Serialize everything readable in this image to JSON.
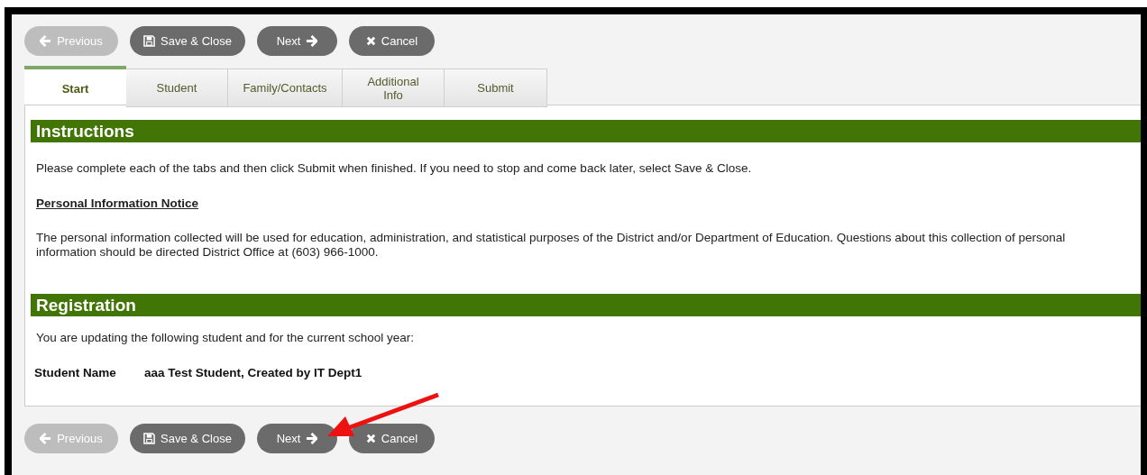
{
  "top_toolbar": [
    {
      "label": "Previous",
      "kind": "previous",
      "disabled": true
    },
    {
      "label": "Save & Close",
      "kind": "save",
      "disabled": false
    },
    {
      "label": "Next",
      "kind": "next",
      "disabled": false
    },
    {
      "label": "Cancel",
      "kind": "cancel",
      "disabled": false
    }
  ],
  "tabs": [
    {
      "label": "Start",
      "selected": true
    },
    {
      "label": "Student",
      "selected": false
    },
    {
      "label": "Family/Contacts",
      "selected": false
    },
    {
      "label": "Additional Info",
      "selected": false
    },
    {
      "label": "Submit",
      "selected": false
    }
  ],
  "instructions": {
    "heading": "Instructions",
    "text": "Please complete each of the tabs and then click Submit when finished. If you need to stop and come back later, select Save & Close.",
    "notice_title": "Personal Information Notice",
    "notice_text": "The personal information collected will be used for education, administration, and statistical purposes of the District and/or Department of Education. Questions about this collection of personal information should be directed District Office at (603) 966-1000."
  },
  "registration": {
    "heading": "Registration",
    "text": "You are updating the following student and for the current school year:",
    "field_label": "Student Name",
    "field_value": "aaa Test Student, Created by IT Dept1"
  },
  "bottom_toolbar": [
    {
      "label": "Previous",
      "kind": "previous",
      "disabled": true
    },
    {
      "label": "Save & Close",
      "kind": "save",
      "disabled": false
    },
    {
      "label": "Next",
      "kind": "next",
      "disabled": false
    },
    {
      "label": "Cancel",
      "kind": "cancel",
      "disabled": false
    }
  ]
}
